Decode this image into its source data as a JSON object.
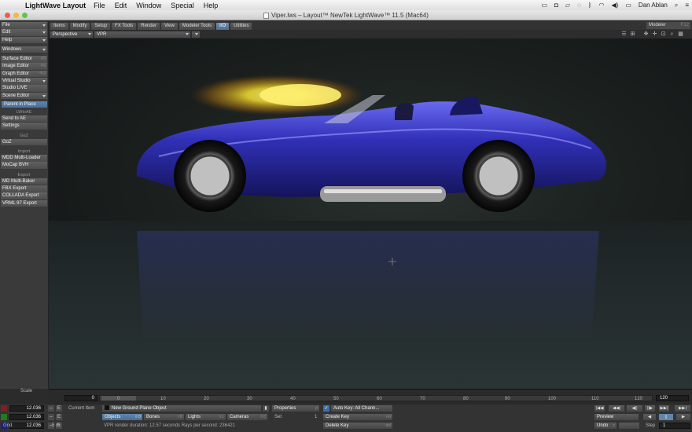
{
  "menubar": {
    "app_name": "LightWave Layout",
    "items": [
      "File",
      "Edit",
      "Window",
      "Special",
      "Help"
    ],
    "user": "Dan Ablan"
  },
  "window": {
    "title": "Viper.lws – Layout™ NewTek LightWave™ 11.5 (Mac64)"
  },
  "left_panel": {
    "top_menus": [
      "File",
      "Edit",
      "Help"
    ],
    "windows_label": "Windows",
    "window_items": [
      {
        "label": "Surface Editor",
        "shortcut": "F5"
      },
      {
        "label": "Image Editor",
        "shortcut": "F6"
      },
      {
        "label": "Graph Editor",
        "shortcut": "^F2"
      },
      {
        "label": "Virtual Studio",
        "shortcut": ""
      },
      {
        "label": "Studio LIVE",
        "shortcut": ""
      },
      {
        "label": "Scene Editor",
        "shortcut": ""
      }
    ],
    "parent_in_place": "Parent in Place",
    "lwtoae_header": "LWtoAE",
    "send_to_ae": "Send to AE",
    "settings": "Settings",
    "goz_header": "GoZ",
    "goz": "GoZ",
    "import_header": "Import",
    "mdd_loader": "MDD Multi-Loader",
    "mocap_bvh": "MoCap BVH",
    "export_header": "Export",
    "md_baker": "MD Multi-Baker",
    "fbx_export": "FBX Export",
    "collada_export": "COLLADA Export",
    "vrml_export": "VRML 97 Export"
  },
  "tabs": [
    "Items",
    "Modify",
    "Setup",
    "FX Tools",
    "Render",
    "View",
    "Modeler Tools",
    "I/O",
    "Utilities"
  ],
  "active_tab": "I/O",
  "modeler": {
    "label": "Modeler",
    "shortcut": "F12"
  },
  "viewport": {
    "view_mode": "Perspective",
    "render_mode": "VPR"
  },
  "timeline": {
    "start": "0",
    "current": "0",
    "end": "120",
    "ticks": [
      "0",
      "10",
      "20",
      "30",
      "40",
      "50",
      "60",
      "70",
      "80",
      "90",
      "100",
      "110",
      "120"
    ]
  },
  "bottom": {
    "scale_label": "Scale",
    "pos_x": "12.036",
    "pos_y": "12.036",
    "pos_z": "12.036",
    "grid_label": "Grid:",
    "grid_value": "5 m",
    "e_label": "E",
    "current_item_label": "Current Item",
    "current_item_value": "New Ground Plane Object",
    "properties": {
      "label": "Properties",
      "shortcut": "p"
    },
    "sel_label": "Sel:",
    "sel_value": "1",
    "auto_key": "Auto Key: All Chann...",
    "create_key": {
      "label": "Create Key",
      "shortcut": "ret"
    },
    "delete_key": {
      "label": "Delete Key",
      "shortcut": "del"
    },
    "objects": {
      "label": "Objects",
      "shortcut": "⇧O"
    },
    "bones": {
      "label": "Bones",
      "shortcut": "⇧B"
    },
    "lights": {
      "label": "Lights",
      "shortcut": "⇧L"
    },
    "cameras": {
      "label": "Cameras",
      "shortcut": "⇧C"
    },
    "status": "VPR render duration: 12.57 seconds  Rays per second: 236421",
    "preview": "Preview",
    "undo": "Undo",
    "undo_shortcut": "z",
    "step_label": "Step",
    "step_value": "1"
  },
  "colors": {
    "accent": "#4f75a0",
    "car_body": "#2a2aa8",
    "flare": "#f0e040"
  }
}
